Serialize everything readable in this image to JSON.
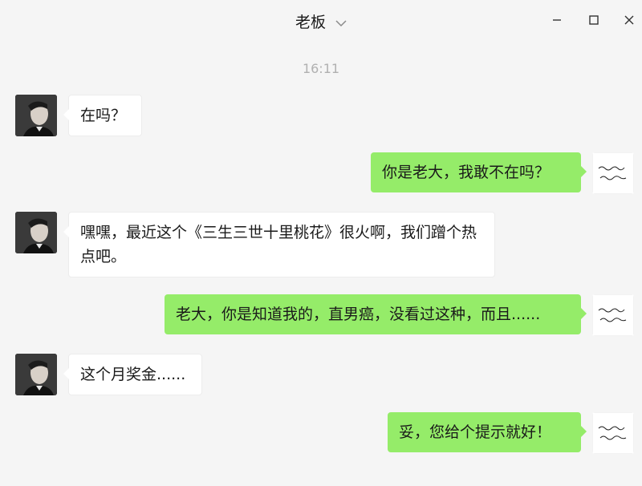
{
  "header": {
    "title": "老板",
    "chevron_icon": "chevron-down-icon",
    "minimize_icon": "minimize-icon",
    "maximize_icon": "maximize-icon",
    "close_icon": "close-icon"
  },
  "chat": {
    "timestamp": "16:11",
    "messages": [
      {
        "side": "in",
        "text": "在吗？"
      },
      {
        "side": "out",
        "text": "你是老大，我敢不在吗？"
      },
      {
        "side": "in",
        "text": "嘿嘿，最近这个《三生三世十里桃花》很火啊，我们蹭个热点吧。"
      },
      {
        "side": "out",
        "text": "老大，你是知道我的，直男癌，没看过这种，而且......"
      },
      {
        "side": "in",
        "text": "这个月奖金......"
      },
      {
        "side": "out",
        "text": "妥，您给个提示就好！"
      }
    ]
  },
  "colors": {
    "background": "#f5f5f5",
    "incoming_bubble": "#ffffff",
    "outgoing_bubble": "#95ec69",
    "timestamp": "#b0b0b0"
  }
}
